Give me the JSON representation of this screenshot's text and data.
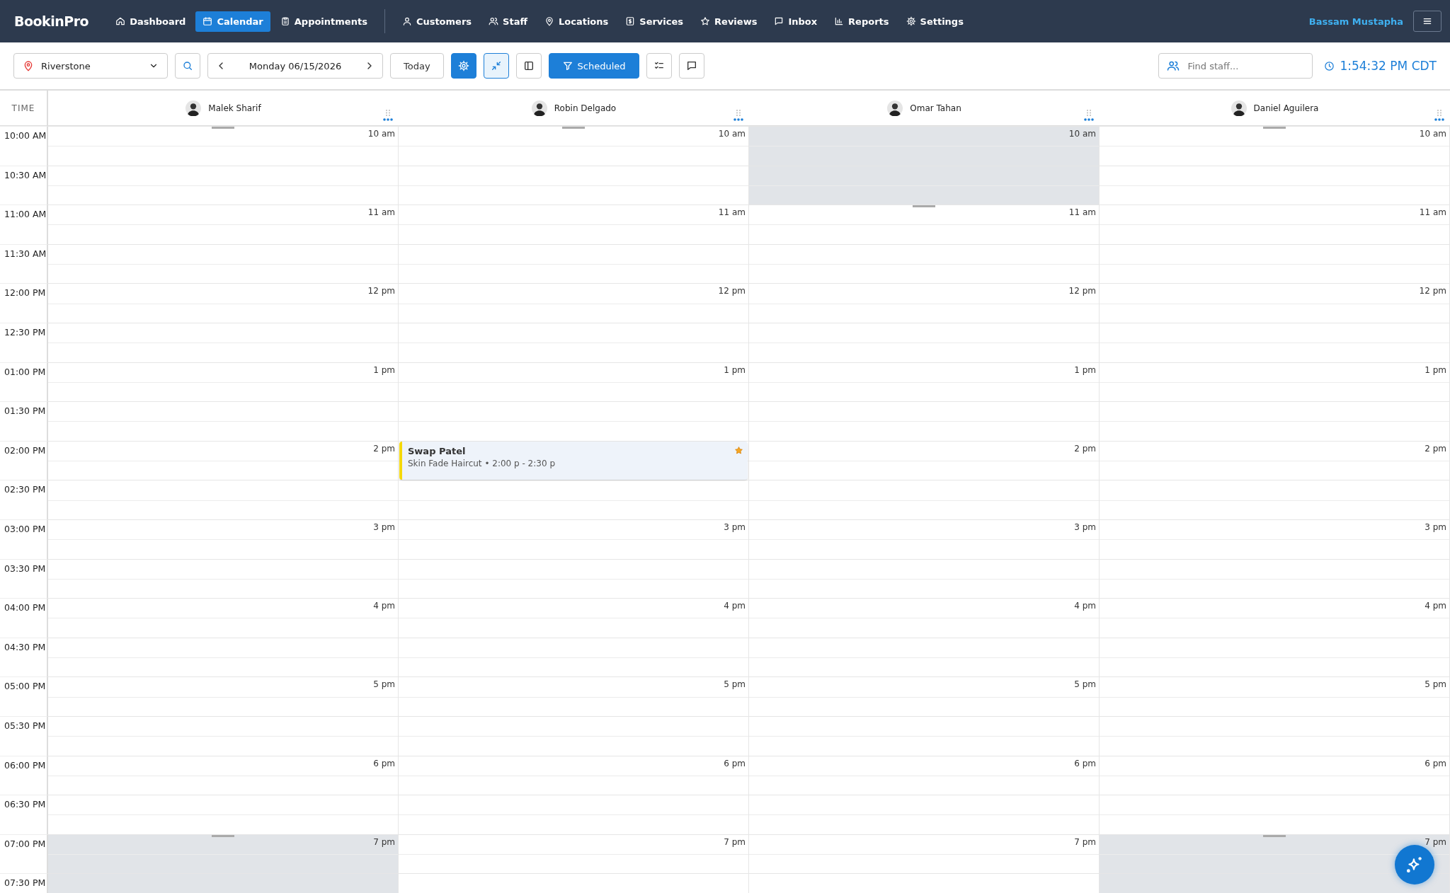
{
  "brand": "BookinPro",
  "nav": [
    {
      "label": "Dashboard",
      "selected": false
    },
    {
      "label": "Calendar",
      "selected": true
    },
    {
      "label": "Appointments",
      "selected": false
    },
    {
      "label": "Customers",
      "selected": false
    },
    {
      "label": "Staff",
      "selected": false
    },
    {
      "label": "Locations",
      "selected": false
    },
    {
      "label": "Services",
      "selected": false
    },
    {
      "label": "Reviews",
      "selected": false
    },
    {
      "label": "Inbox",
      "selected": false
    },
    {
      "label": "Reports",
      "selected": false
    },
    {
      "label": "Settings",
      "selected": false
    }
  ],
  "user": "Bassam Mustapha",
  "toolbar": {
    "location": "Riverstone",
    "date": "Monday 06/15/2026",
    "today": "Today",
    "filter": "Scheduled",
    "staff_search": {
      "placeholder": "Find staff..."
    },
    "clock": "1:54:32 PM CDT"
  },
  "time_header": "TIME",
  "staff": [
    "Malek Sharif",
    "Robin Delgado",
    "Omar Tahan",
    "Daniel Aguilera"
  ],
  "rows": [
    {
      "time": "10:00 AM",
      "cells": [
        {
          "label": "10 am",
          "blocked": false
        },
        {
          "label": "10 am",
          "blocked": false
        },
        {
          "label": "10 am",
          "blocked": true
        },
        {
          "label": "10 am",
          "blocked": false
        }
      ]
    },
    {
      "time": "10:30 AM",
      "cells": [
        {
          "blocked": false
        },
        {
          "blocked": false
        },
        {
          "blocked": true
        },
        {
          "blocked": false
        }
      ]
    },
    {
      "time": "11:00 AM",
      "cells": [
        {
          "label": "11 am",
          "blocked": false
        },
        {
          "label": "11 am",
          "blocked": false
        },
        {
          "label": "11 am",
          "blocked": false
        },
        {
          "label": "11 am",
          "blocked": false
        }
      ]
    },
    {
      "time": "11:30 AM",
      "cells": [
        {
          "blocked": false
        },
        {
          "blocked": false
        },
        {
          "blocked": false
        },
        {
          "blocked": false
        }
      ]
    },
    {
      "time": "12:00 PM",
      "cells": [
        {
          "label": "12 pm",
          "blocked": false
        },
        {
          "label": "12 pm",
          "blocked": false
        },
        {
          "label": "12 pm",
          "blocked": false
        },
        {
          "label": "12 pm",
          "blocked": false
        }
      ]
    },
    {
      "time": "12:30 PM",
      "cells": [
        {
          "blocked": false
        },
        {
          "blocked": false
        },
        {
          "blocked": false
        },
        {
          "blocked": false
        }
      ]
    },
    {
      "time": "01:00 PM",
      "cells": [
        {
          "label": "1 pm",
          "blocked": false
        },
        {
          "label": "1 pm",
          "blocked": false
        },
        {
          "label": "1 pm",
          "blocked": false
        },
        {
          "label": "1 pm",
          "blocked": false
        }
      ]
    },
    {
      "time": "01:30 PM",
      "cells": [
        {
          "blocked": false
        },
        {
          "blocked": false
        },
        {
          "blocked": false
        },
        {
          "blocked": false
        }
      ]
    },
    {
      "time": "02:00 PM",
      "cells": [
        {
          "label": "2 pm",
          "blocked": false
        },
        {
          "blocked": false,
          "appointment": {
            "client": "Swap Patel",
            "details": "Skin Fade Haircut • 2:00 p - 2:30 p",
            "color": "#f5d90a",
            "starred": true
          }
        },
        {
          "label": "2 pm",
          "blocked": false
        },
        {
          "label": "2 pm",
          "blocked": false
        }
      ]
    },
    {
      "time": "02:30 PM",
      "cells": [
        {
          "blocked": false
        },
        {
          "blocked": false
        },
        {
          "blocked": false
        },
        {
          "blocked": false
        }
      ]
    },
    {
      "time": "03:00 PM",
      "cells": [
        {
          "label": "3 pm",
          "blocked": false
        },
        {
          "label": "3 pm",
          "blocked": false
        },
        {
          "label": "3 pm",
          "blocked": false
        },
        {
          "label": "3 pm",
          "blocked": false
        }
      ]
    },
    {
      "time": "03:30 PM",
      "cells": [
        {
          "blocked": false
        },
        {
          "blocked": false
        },
        {
          "blocked": false
        },
        {
          "blocked": false
        }
      ]
    },
    {
      "time": "04:00 PM",
      "cells": [
        {
          "label": "4 pm",
          "blocked": false
        },
        {
          "label": "4 pm",
          "blocked": false
        },
        {
          "label": "4 pm",
          "blocked": false
        },
        {
          "label": "4 pm",
          "blocked": false
        }
      ]
    },
    {
      "time": "04:30 PM",
      "cells": [
        {
          "blocked": false
        },
        {
          "blocked": false
        },
        {
          "blocked": false
        },
        {
          "blocked": false
        }
      ]
    },
    {
      "time": "05:00 PM",
      "cells": [
        {
          "label": "5 pm",
          "blocked": false
        },
        {
          "label": "5 pm",
          "blocked": false
        },
        {
          "label": "5 pm",
          "blocked": false
        },
        {
          "label": "5 pm",
          "blocked": false
        }
      ]
    },
    {
      "time": "05:30 PM",
      "cells": [
        {
          "blocked": false
        },
        {
          "blocked": false
        },
        {
          "blocked": false
        },
        {
          "blocked": false
        }
      ]
    },
    {
      "time": "06:00 PM",
      "cells": [
        {
          "label": "6 pm",
          "blocked": false
        },
        {
          "label": "6 pm",
          "blocked": false
        },
        {
          "label": "6 pm",
          "blocked": false
        },
        {
          "label": "6 pm",
          "blocked": false
        }
      ]
    },
    {
      "time": "06:30 PM",
      "cells": [
        {
          "blocked": false
        },
        {
          "blocked": false
        },
        {
          "blocked": false
        },
        {
          "blocked": false
        }
      ]
    },
    {
      "time": "07:00 PM",
      "cells": [
        {
          "label": "7 pm",
          "blocked": true
        },
        {
          "label": "7 pm",
          "blocked": false
        },
        {
          "label": "7 pm",
          "blocked": false
        },
        {
          "label": "7 pm",
          "blocked": true
        }
      ]
    },
    {
      "time": "07:30 PM",
      "cells": [
        {
          "blocked": true
        },
        {
          "blocked": false
        },
        {
          "blocked": false
        },
        {
          "blocked": true
        }
      ]
    }
  ]
}
